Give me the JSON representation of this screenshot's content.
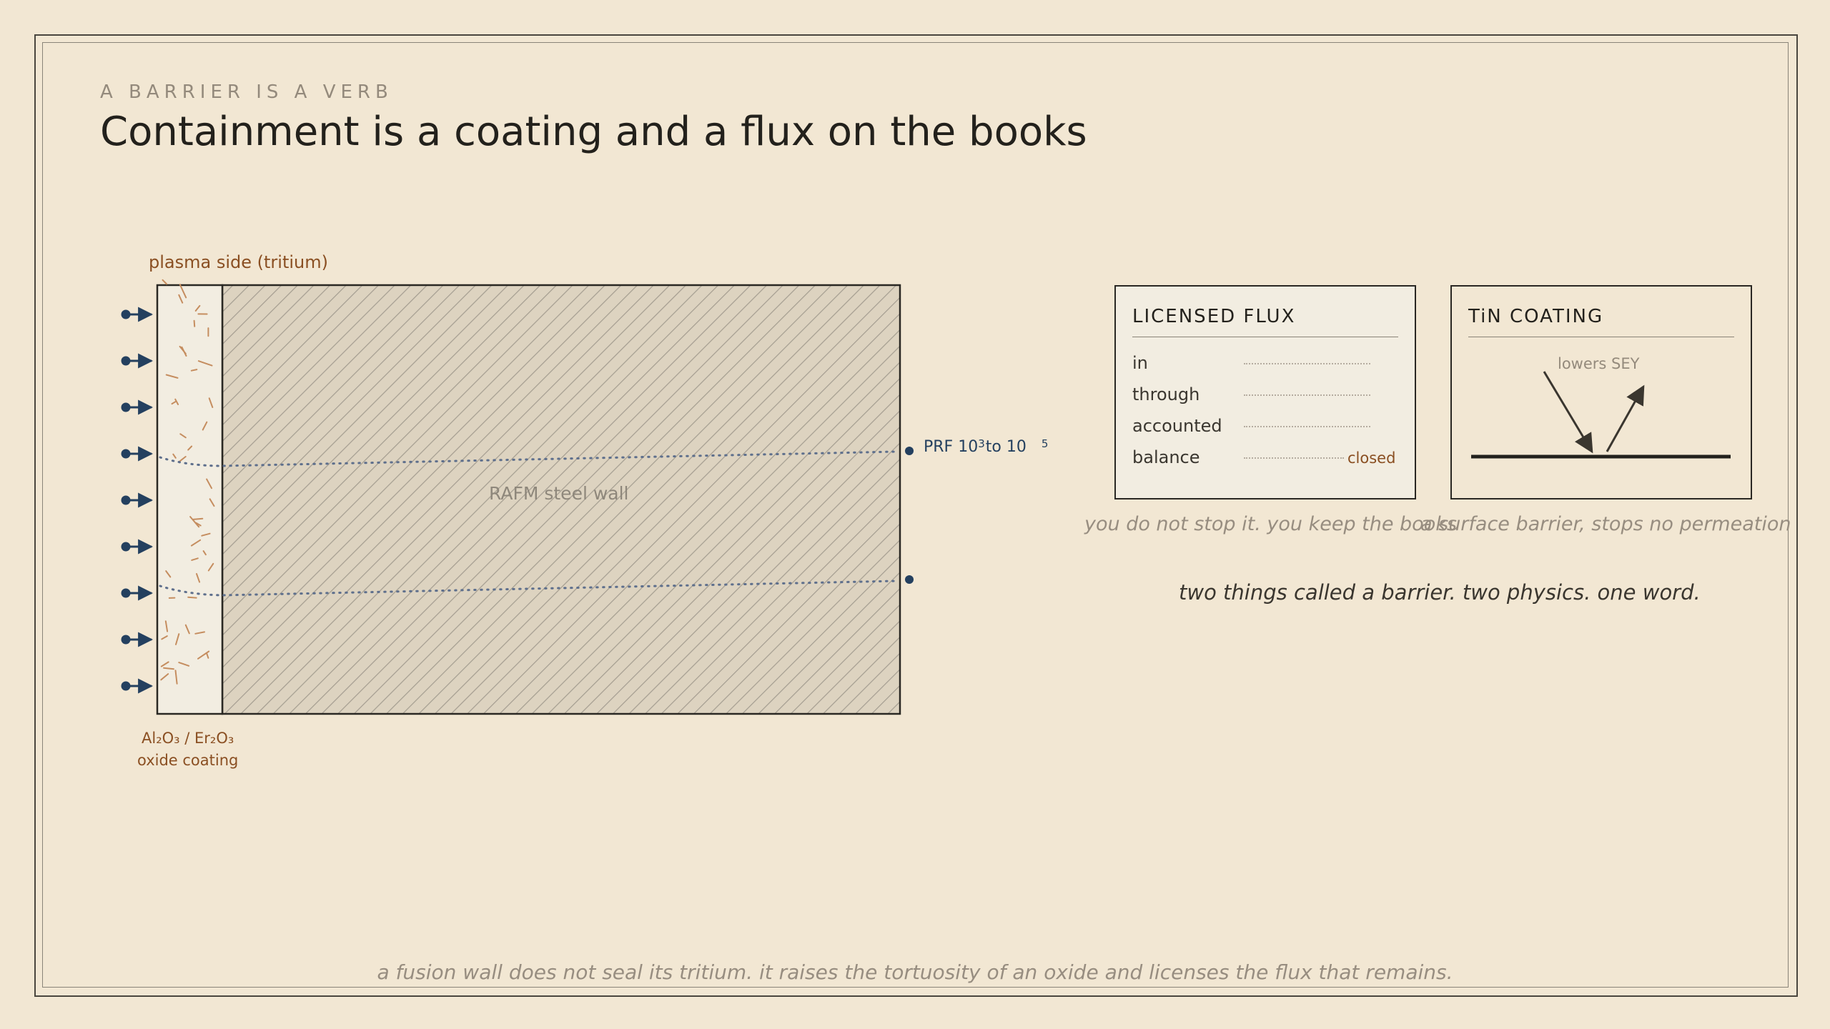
{
  "kicker": "A BARRIER IS A VERB",
  "title": "Containment is a coating and a flux on the books",
  "diagram": {
    "plasma_label": "plasma side (tritium)",
    "wall_label": "RAFM steel wall",
    "coating_label_line1": "Al₂O₃ / Er₂O₃",
    "coating_label_line2": "oxide coating",
    "prf_label": {
      "prefix": "PRF 10",
      "exp1": "3",
      "middle": "to 10",
      "exp2": "5"
    },
    "incoming_arrows": 9,
    "permeation_paths": 2
  },
  "licensed_flux": {
    "title": "LICENSED FLUX",
    "rows": [
      {
        "label": "in",
        "value": ""
      },
      {
        "label": "through",
        "value": ""
      },
      {
        "label": "accounted",
        "value": ""
      },
      {
        "label": "balance",
        "value": "closed"
      }
    ],
    "caption": "you do not stop it. you keep the books"
  },
  "tin_coating": {
    "title": "TiN COATING",
    "note": "lowers SEY",
    "caption": "a surface barrier, stops no permeation"
  },
  "tagline": "two things called a barrier. two physics. one word.",
  "footer": "a fusion wall does not seal its tritium. it raises the tortuosity of an oxide and licenses the flux that remains.",
  "colors": {
    "background": "#f2e7d3",
    "ink": "#23211c",
    "copper": "#8a4f22",
    "navy": "#24405f",
    "muted": "#978d80",
    "steel": "#ddd3c0"
  }
}
